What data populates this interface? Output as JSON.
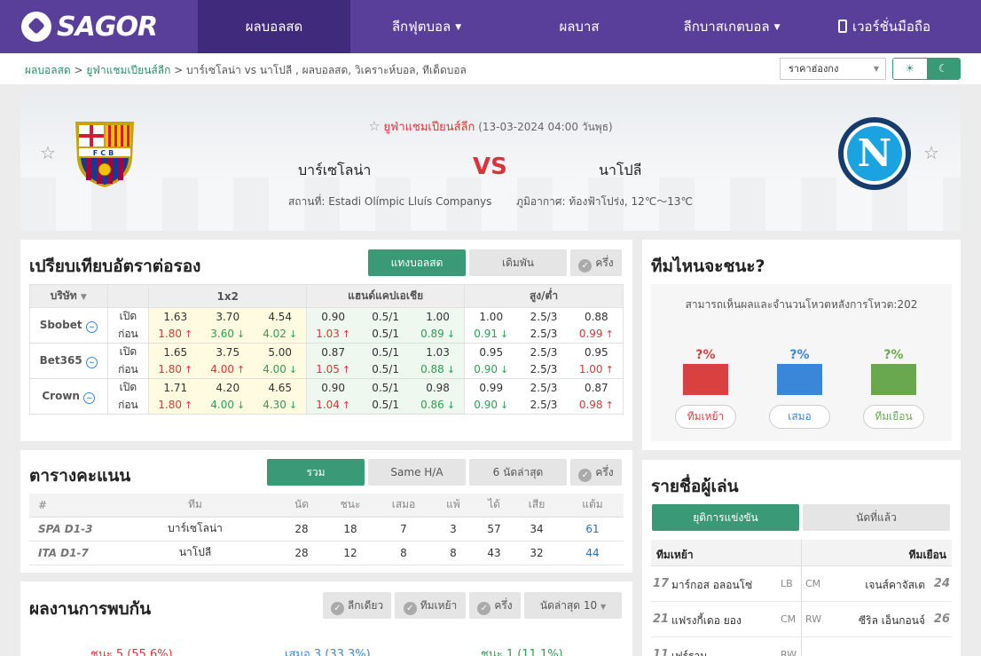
{
  "nav": {
    "logo": "SAGOR",
    "items": [
      "ผลบอลสด",
      "ลีกฟุตบอล",
      "ผลบาส",
      "ลีกบาสเกตบอล",
      "เวอร์ชั่นมือถือ"
    ]
  },
  "breadcrumb": {
    "home": "ผลบอลสด",
    "league": "ยูฟ่าแชมเปียนส์ลีก",
    "page": "บาร์เซโลน่า vs  นาโปลี ,  ผลบอลสด,  วิเคราะห์บอล,  ทีเด็ดบอล"
  },
  "odds_select": "ราคาฮ่องกง",
  "match": {
    "competition": "ยูฟ่าแชมเปียนส์ลีก",
    "datetime": "(13-03-2024 04:00 วันพุธ)",
    "home": "บาร์เซโลน่า",
    "away": "นาโปลี",
    "vs": "VS",
    "venue": "สถานที่: Estadi Olímpic Lluís Companys",
    "weather": "ภูมิอากาศ: ท้องฟ้าโปร่ง, 12℃～13℃",
    "home_crest": "FCB"
  },
  "odds": {
    "title": "เปรียบเทียบอัตราต่อรอง",
    "tabs": [
      "แทงบอลสด",
      "เดิมพัน"
    ],
    "half": "ครึ่ง",
    "headers": {
      "company": "บริษัท",
      "x12": "1x2",
      "hdp": "แฮนด์แคปเอเชีย",
      "ou": "สูง/ต่ำ"
    },
    "open": "เปิด",
    "before": "ก่อน",
    "companies": [
      {
        "name": "Sbobet",
        "open": [
          "1.63",
          "3.70",
          "4.54",
          "0.90",
          "0.5/1",
          "1.00",
          "1.00",
          "2.5/3",
          "0.88"
        ],
        "before": [
          "1.80",
          "3.60",
          "4.02",
          "1.03",
          "0.5/1",
          "0.89",
          "0.91",
          "2.5/3",
          "0.99"
        ],
        "dir": [
          "u",
          "d",
          "d",
          "u",
          "",
          "d",
          "d",
          "",
          "u"
        ]
      },
      {
        "name": "Bet365",
        "open": [
          "1.65",
          "3.75",
          "5.00",
          "0.87",
          "0.5/1",
          "1.03",
          "0.95",
          "2.5/3",
          "0.95"
        ],
        "before": [
          "1.80",
          "4.00",
          "4.00",
          "1.05",
          "0.5/1",
          "0.88",
          "0.90",
          "2.5/3",
          "1.00"
        ],
        "dir": [
          "u",
          "u",
          "d",
          "u",
          "",
          "d",
          "d",
          "",
          "u"
        ]
      },
      {
        "name": "Crown",
        "open": [
          "1.71",
          "4.20",
          "4.65",
          "0.90",
          "0.5/1",
          "0.98",
          "0.99",
          "2.5/3",
          "0.87"
        ],
        "before": [
          "1.80",
          "4.00",
          "4.30",
          "1.04",
          "0.5/1",
          "0.86",
          "0.90",
          "2.5/3",
          "0.98"
        ],
        "dir": [
          "u",
          "d",
          "d",
          "u",
          "",
          "d",
          "d",
          "",
          "u"
        ]
      }
    ]
  },
  "vote": {
    "title": "ทีมไหนจะชนะ?",
    "note": "สามารถเห็นผลและจำนวนโหวตหลังการโหวต:202",
    "home_pct": "?%",
    "draw_pct": "?%",
    "away_pct": "?%",
    "home_label": "ทีมเหย้า",
    "draw_label": "เสมอ",
    "away_label": "ทีมเยือน"
  },
  "standings": {
    "title": "ตารางคะแนน",
    "tabs": [
      "รวม",
      "Same H/A",
      "6 นัดล่าสุด"
    ],
    "half": "ครึ่ง",
    "headers": [
      "#",
      "ทีม",
      "นัด",
      "ชนะ",
      "เสมอ",
      "แพ้",
      "ได้",
      "เสีย",
      "แต้ม"
    ],
    "rows": [
      [
        "SPA D1-3",
        "บาร์เซโลน่า",
        "28",
        "18",
        "7",
        "3",
        "57",
        "34",
        "61"
      ],
      [
        "ITA D1-7",
        "นาโปลี",
        "28",
        "12",
        "8",
        "8",
        "43",
        "32",
        "44"
      ]
    ]
  },
  "h2h": {
    "title": "ผลงานการพบกัน",
    "filters": [
      "ลีกเดียว",
      "ทีมเหย้า",
      "ครึ่ง"
    ],
    "last": "นัดล่าสุด 10",
    "win": "ชนะ 5 (55.6%)",
    "draw": "เสมอ 3 (33.3%)",
    "lose": "ชนะ 1 (11.1%)"
  },
  "lineup": {
    "title": "รายชื่อผู้เล่น",
    "tabs": [
      "ยุติการแข่งขัน",
      "นัดที่แล้ว"
    ],
    "home_h": "ทีมเหย้า",
    "away_h": "ทีมเยือน",
    "rows": [
      {
        "hn": "17",
        "hname": "มาร์กอส อลอนโซ่",
        "hpos": "LB",
        "apos": "CM",
        "aname": "เจนส์คาจัสเต",
        "an": "24"
      },
      {
        "hn": "21",
        "hname": "แฟรงกี้เดอ ยอง",
        "hpos": "CM",
        "apos": "RW",
        "aname": "ซีริล เอ็นกอนจ์",
        "an": "26"
      },
      {
        "hn": "11",
        "hname": "เฟร์ราน",
        "hpos": "RW",
        "apos": "",
        "aname": "",
        "an": ""
      }
    ]
  },
  "colors": {
    "brand": "#5a3f9a",
    "accent": "#3a9a77",
    "red": "#d9343a",
    "home_bar": "#d94040",
    "draw_bar": "#3a87d9",
    "away_bar": "#6aa84f"
  }
}
